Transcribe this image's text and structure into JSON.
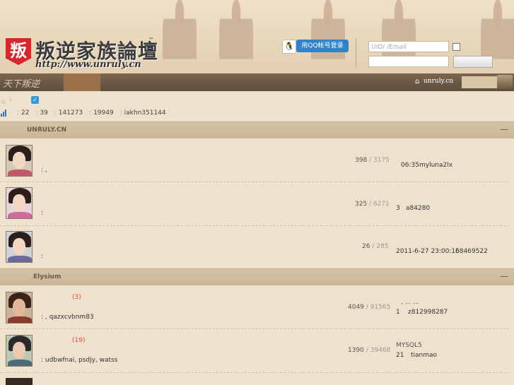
{
  "header": {
    "logo_mark": "叛",
    "logo_title": "叛逆家族論壇",
    "logo_tm": "™",
    "logo_url": "http://www.unruly.cn",
    "qq_login_label": "用QQ帐号登录",
    "uid_placeholder": "UID/ /Email"
  },
  "nav": {
    "logo_text": "天下叛逆",
    "domain": "unruly.cn"
  },
  "stats": {
    "items": [
      "22",
      "39",
      "141273",
      "19949",
      "iakhn351144"
    ]
  },
  "categories": [
    {
      "title": "UNRULY.CN",
      "forums": [
        {
          "name_extra": "",
          "desc": ":  ,",
          "topics": "398",
          "posts": "3175",
          "last_time": "06:35",
          "last_user": "myluna2lx"
        },
        {
          "name_extra": "",
          "desc": ":",
          "topics": "325",
          "posts": "6271",
          "last_time": "3",
          "last_user": "a84280"
        },
        {
          "name_extra": "",
          "desc": ":",
          "topics": "26",
          "posts": "285",
          "last_time": "2011-6-27 23:00:15",
          "last_user": "68469522"
        }
      ]
    },
    {
      "title": "Elysium",
      "forums": [
        {
          "name_extra": "(3)",
          "desc": ":    , qazxcvbnm83",
          "topics": "4049",
          "posts": "91565",
          "last_title": ",   ...   ...",
          "last_time": "1",
          "last_user": "z812998287"
        },
        {
          "name_extra": "(19)",
          "desc": ": udbwfnai, psdjy, watss",
          "topics": "1390",
          "posts": "39468",
          "last_title": "MYSQL5",
          "last_time": "21",
          "last_user": "tianmao"
        }
      ]
    }
  ],
  "colors": {
    "accent_blue": "#2f83c8",
    "brand_red": "#d9262a",
    "category_bar": "#cfbd9d",
    "background": "#eee2cc"
  }
}
